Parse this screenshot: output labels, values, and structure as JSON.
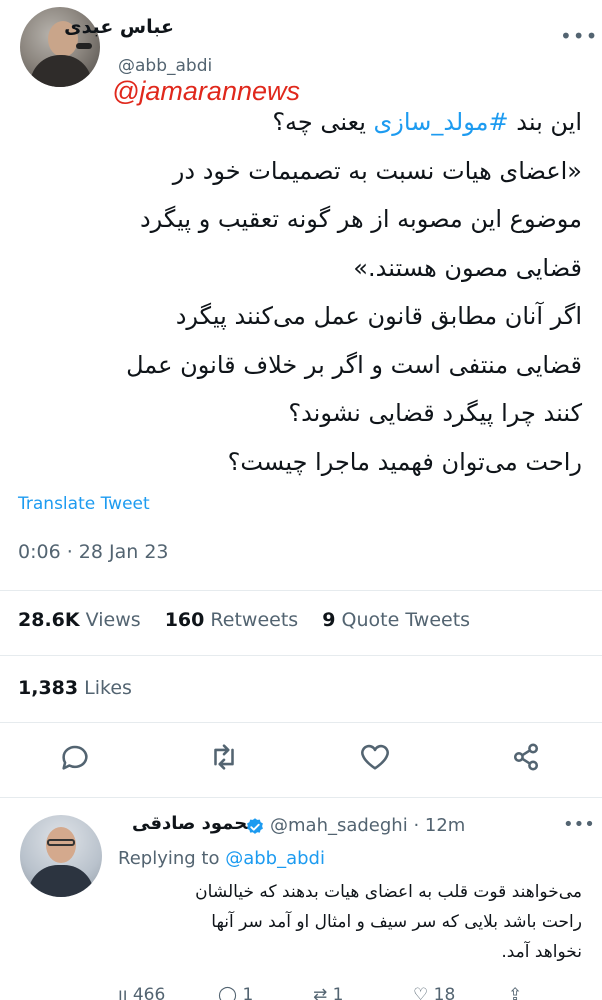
{
  "tweet": {
    "author_name": "عباس عبدی",
    "author_handle": "@abb_abdi",
    "watermark": "@jamarannews",
    "lines": [
      {
        "pre": "این بند ",
        "hashtag": "#مولد_سازی",
        "post": " یعنی چه؟"
      },
      {
        "pre": "«اعضای هیات نسبت به تصمیمات خود در",
        "hashtag": "",
        "post": ""
      },
      {
        "pre": "موضوع این مصوبه از هر گونه تعقیب و پیگرد",
        "hashtag": "",
        "post": ""
      },
      {
        "pre": "قضایی مصون هستند.»",
        "hashtag": "",
        "post": ""
      },
      {
        "pre": "اگر آنان مطابق قانون عمل می‌کنند پیگرد",
        "hashtag": "",
        "post": ""
      },
      {
        "pre": "قضایی منتفی است و اگر بر خلاف قانون عمل",
        "hashtag": "",
        "post": ""
      },
      {
        "pre": "کنند چرا پیگرد قضایی نشوند؟",
        "hashtag": "",
        "post": ""
      },
      {
        "pre": "راحت می‌توان فهمید ماجرا چیست؟",
        "hashtag": "",
        "post": ""
      }
    ],
    "translate_label": "Translate Tweet",
    "timestamp": "0:06 · 28 Jan 23"
  },
  "stats": {
    "views_count": "28.6K",
    "views_label": "Views",
    "retweets_count": "160",
    "retweets_label": "Retweets",
    "quotes_count": "9",
    "quotes_label": "Quote Tweets",
    "likes_count": "1,383",
    "likes_label": "Likes"
  },
  "actions": {
    "reply_icon": "reply-icon",
    "retweet_icon": "retweet-icon",
    "like_icon": "like-icon",
    "share_icon": "share-icon"
  },
  "reply": {
    "name": "محمود صادقی",
    "handle": "@mah_sadeghi · 12m",
    "replying_prefix": "Replying to ",
    "replying_handle": "@abb_abdi",
    "lines": [
      "می‌خواهند قوت قلب به اعضای هیات بدهند که خیالشان",
      "راحت باشد بلایی که سر سیف و امثال او آمد سر آنها",
      "نخواهد آمد."
    ],
    "views": "466",
    "replies": "1",
    "retweets": "1",
    "likes": "18"
  },
  "colors": {
    "accent": "#1d9bf0",
    "secondary_text": "#536471",
    "watermark": "#e0281c"
  }
}
